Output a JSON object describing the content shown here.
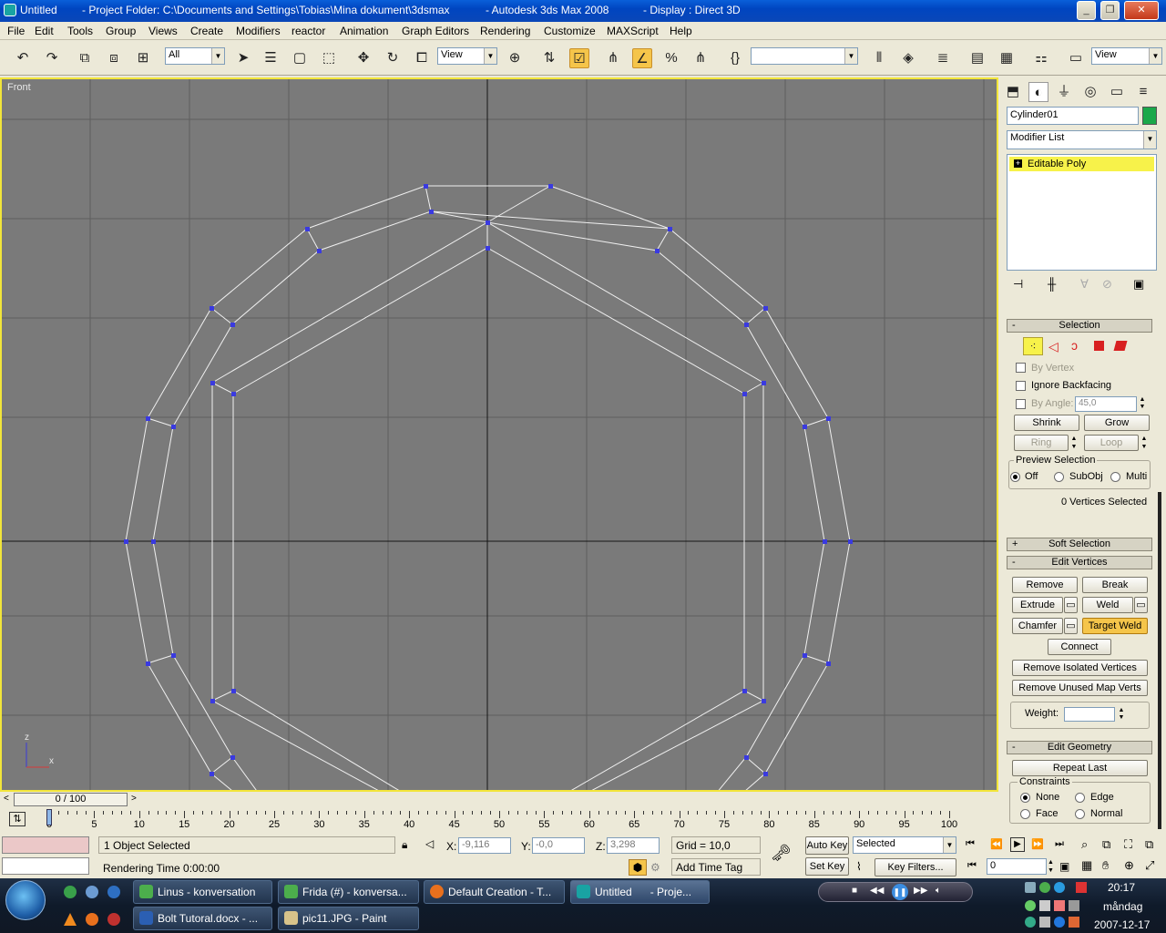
{
  "window": {
    "title_app": "Untitled",
    "title_project": "- Project Folder: C:\\Documents and Settings\\Tobias\\Mina dokument\\3dsmax",
    "title_product": "- Autodesk 3ds Max 2008",
    "title_display": "- Display : Direct 3D"
  },
  "menu": [
    "File",
    "Edit",
    "Tools",
    "Group",
    "Views",
    "Create",
    "Modifiers",
    "reactor",
    "Animation",
    "Graph Editors",
    "Rendering",
    "Customize",
    "MAXScript",
    "Help"
  ],
  "toolbar": {
    "selection_filter": "All",
    "ref_coord": "View",
    "named_sel": "",
    "view_dropdown": "View"
  },
  "viewport": {
    "label": "Front",
    "axis_z": "z",
    "axis_x": "x"
  },
  "command_panel": {
    "object_name": "Cylinder01",
    "object_color": "#1aa84a",
    "modifier_list": "Modifier List",
    "stack_item": "Editable Poly",
    "selection": {
      "title": "Selection",
      "by_vertex": "By Vertex",
      "ignore_backfacing": "Ignore Backfacing",
      "by_angle": "By Angle:",
      "angle_value": "45,0",
      "shrink": "Shrink",
      "grow": "Grow",
      "ring": "Ring",
      "loop": "Loop",
      "preview_title": "Preview Selection",
      "off": "Off",
      "subobj": "SubObj",
      "multi": "Multi",
      "status": "0 Vertices Selected"
    },
    "soft_selection": "Soft Selection",
    "edit_vertices": {
      "title": "Edit Vertices",
      "remove": "Remove",
      "break": "Break",
      "extrude": "Extrude",
      "weld": "Weld",
      "chamfer": "Chamfer",
      "target_weld": "Target Weld",
      "connect": "Connect",
      "remove_isolated": "Remove Isolated Vertices",
      "remove_unused": "Remove Unused Map Verts",
      "weight": "Weight:"
    },
    "edit_geometry": {
      "title": "Edit Geometry",
      "repeat_last": "Repeat Last",
      "constraints": "Constraints",
      "none": "None",
      "edge": "Edge",
      "face": "Face",
      "normal": "Normal"
    }
  },
  "timeline": {
    "frame": "0 / 100",
    "ticks": [
      "0",
      "5",
      "10",
      "15",
      "20",
      "25",
      "30",
      "35",
      "40",
      "45",
      "50",
      "55",
      "60",
      "65",
      "70",
      "75",
      "80",
      "85",
      "90",
      "95",
      "100"
    ]
  },
  "status": {
    "objects_selected": "1 Object Selected",
    "rendering_time": "Rendering Time  0:00:00",
    "x_label": "X:",
    "x_value": "-9,116",
    "y_label": "Y:",
    "y_value": "-0,0",
    "z_label": "Z:",
    "z_value": "3,298",
    "grid": "Grid = 10,0",
    "add_time_tag": "Add Time Tag",
    "auto_key": "Auto Key",
    "set_key": "Set Key",
    "selected_dd": "Selected",
    "key_filters": "Key Filters...",
    "frame_field": "0"
  },
  "taskbar": {
    "row1": [
      "Linus - konversation",
      "Frida (#) - konversa...",
      "Default Creation - T...",
      "Untitled      - Proje..."
    ],
    "row2": [
      "Bolt Tutoral.docx - ...",
      "pic11.JPG - Paint"
    ],
    "time": "20:17",
    "day": "måndag",
    "date": "2007-12-17"
  }
}
